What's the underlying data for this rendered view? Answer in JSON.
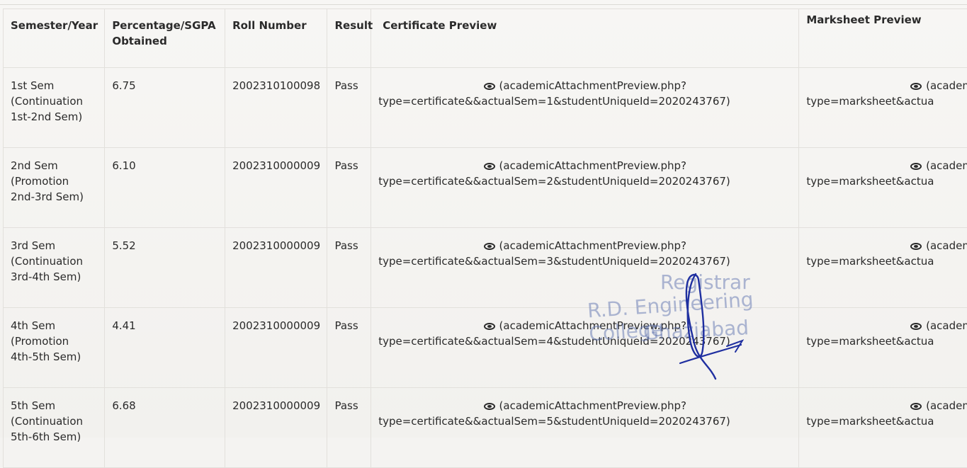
{
  "table": {
    "headers": {
      "semester": "Semester/Year",
      "percentage_line1": "Percentage/SGPA",
      "percentage_line2": "Obtained",
      "roll": "Roll Number",
      "result": "Result",
      "certificate": "Certificate Preview",
      "marksheet": "Marksheet Preview"
    },
    "rows": [
      {
        "sem_line1": "1st Sem",
        "sem_line2": "(Continuation",
        "sem_line3": "1st-2nd Sem)",
        "percentage": "6.75",
        "roll": "2002310100098",
        "result": "Pass",
        "cert_line1": "(academicAttachmentPreview.php?",
        "cert_line2": "type=certificate&&actualSem=1&studentUniqueId=2020243767)",
        "mark_line1": "(academ",
        "mark_line2": "type=marksheet&actua"
      },
      {
        "sem_line1": "2nd Sem",
        "sem_line2": "(Promotion",
        "sem_line3": "2nd-3rd Sem)",
        "percentage": "6.10",
        "roll": "2002310000009",
        "result": "Pass",
        "cert_line1": "(academicAttachmentPreview.php?",
        "cert_line2": "type=certificate&&actualSem=2&studentUniqueId=2020243767)",
        "mark_line1": "(academ",
        "mark_line2": "type=marksheet&actua"
      },
      {
        "sem_line1": "3rd Sem",
        "sem_line2": "(Continuation",
        "sem_line3": "3rd-4th Sem)",
        "percentage": "5.52",
        "roll": "2002310000009",
        "result": "Pass",
        "cert_line1": "(academicAttachmentPreview.php?",
        "cert_line2": "type=certificate&&actualSem=3&studentUniqueId=2020243767)",
        "mark_line1": "(academ",
        "mark_line2": "type=marksheet&actua"
      },
      {
        "sem_line1": "4th Sem",
        "sem_line2": "(Promotion",
        "sem_line3": "4th-5th Sem)",
        "percentage": "4.41",
        "roll": "2002310000009",
        "result": "Pass",
        "cert_line1": "(academicAttachmentPreview.php?",
        "cert_line2": "type=certificate&&actualSem=4&studentUniqueId=2020243767)",
        "mark_line1": "(academ",
        "mark_line2": "type=marksheet&actua"
      },
      {
        "sem_line1": "5th Sem",
        "sem_line2": "(Continuation",
        "sem_line3": "5th-6th Sem)",
        "percentage": "6.68",
        "roll": "2002310000009",
        "result": "Pass",
        "cert_line1": "(academicAttachmentPreview.php?",
        "cert_line2": "type=certificate&&actualSem=5&studentUniqueId=2020243767)",
        "mark_line1": "(academ",
        "mark_line2": "type=marksheet&actua"
      }
    ]
  },
  "stamp": {
    "line1": "Registrar",
    "line2": "R.D. Engineering College",
    "line3": "Ghaziabad"
  },
  "colors": {
    "stamp": "#5f73af",
    "signature": "#1f2fa0"
  }
}
